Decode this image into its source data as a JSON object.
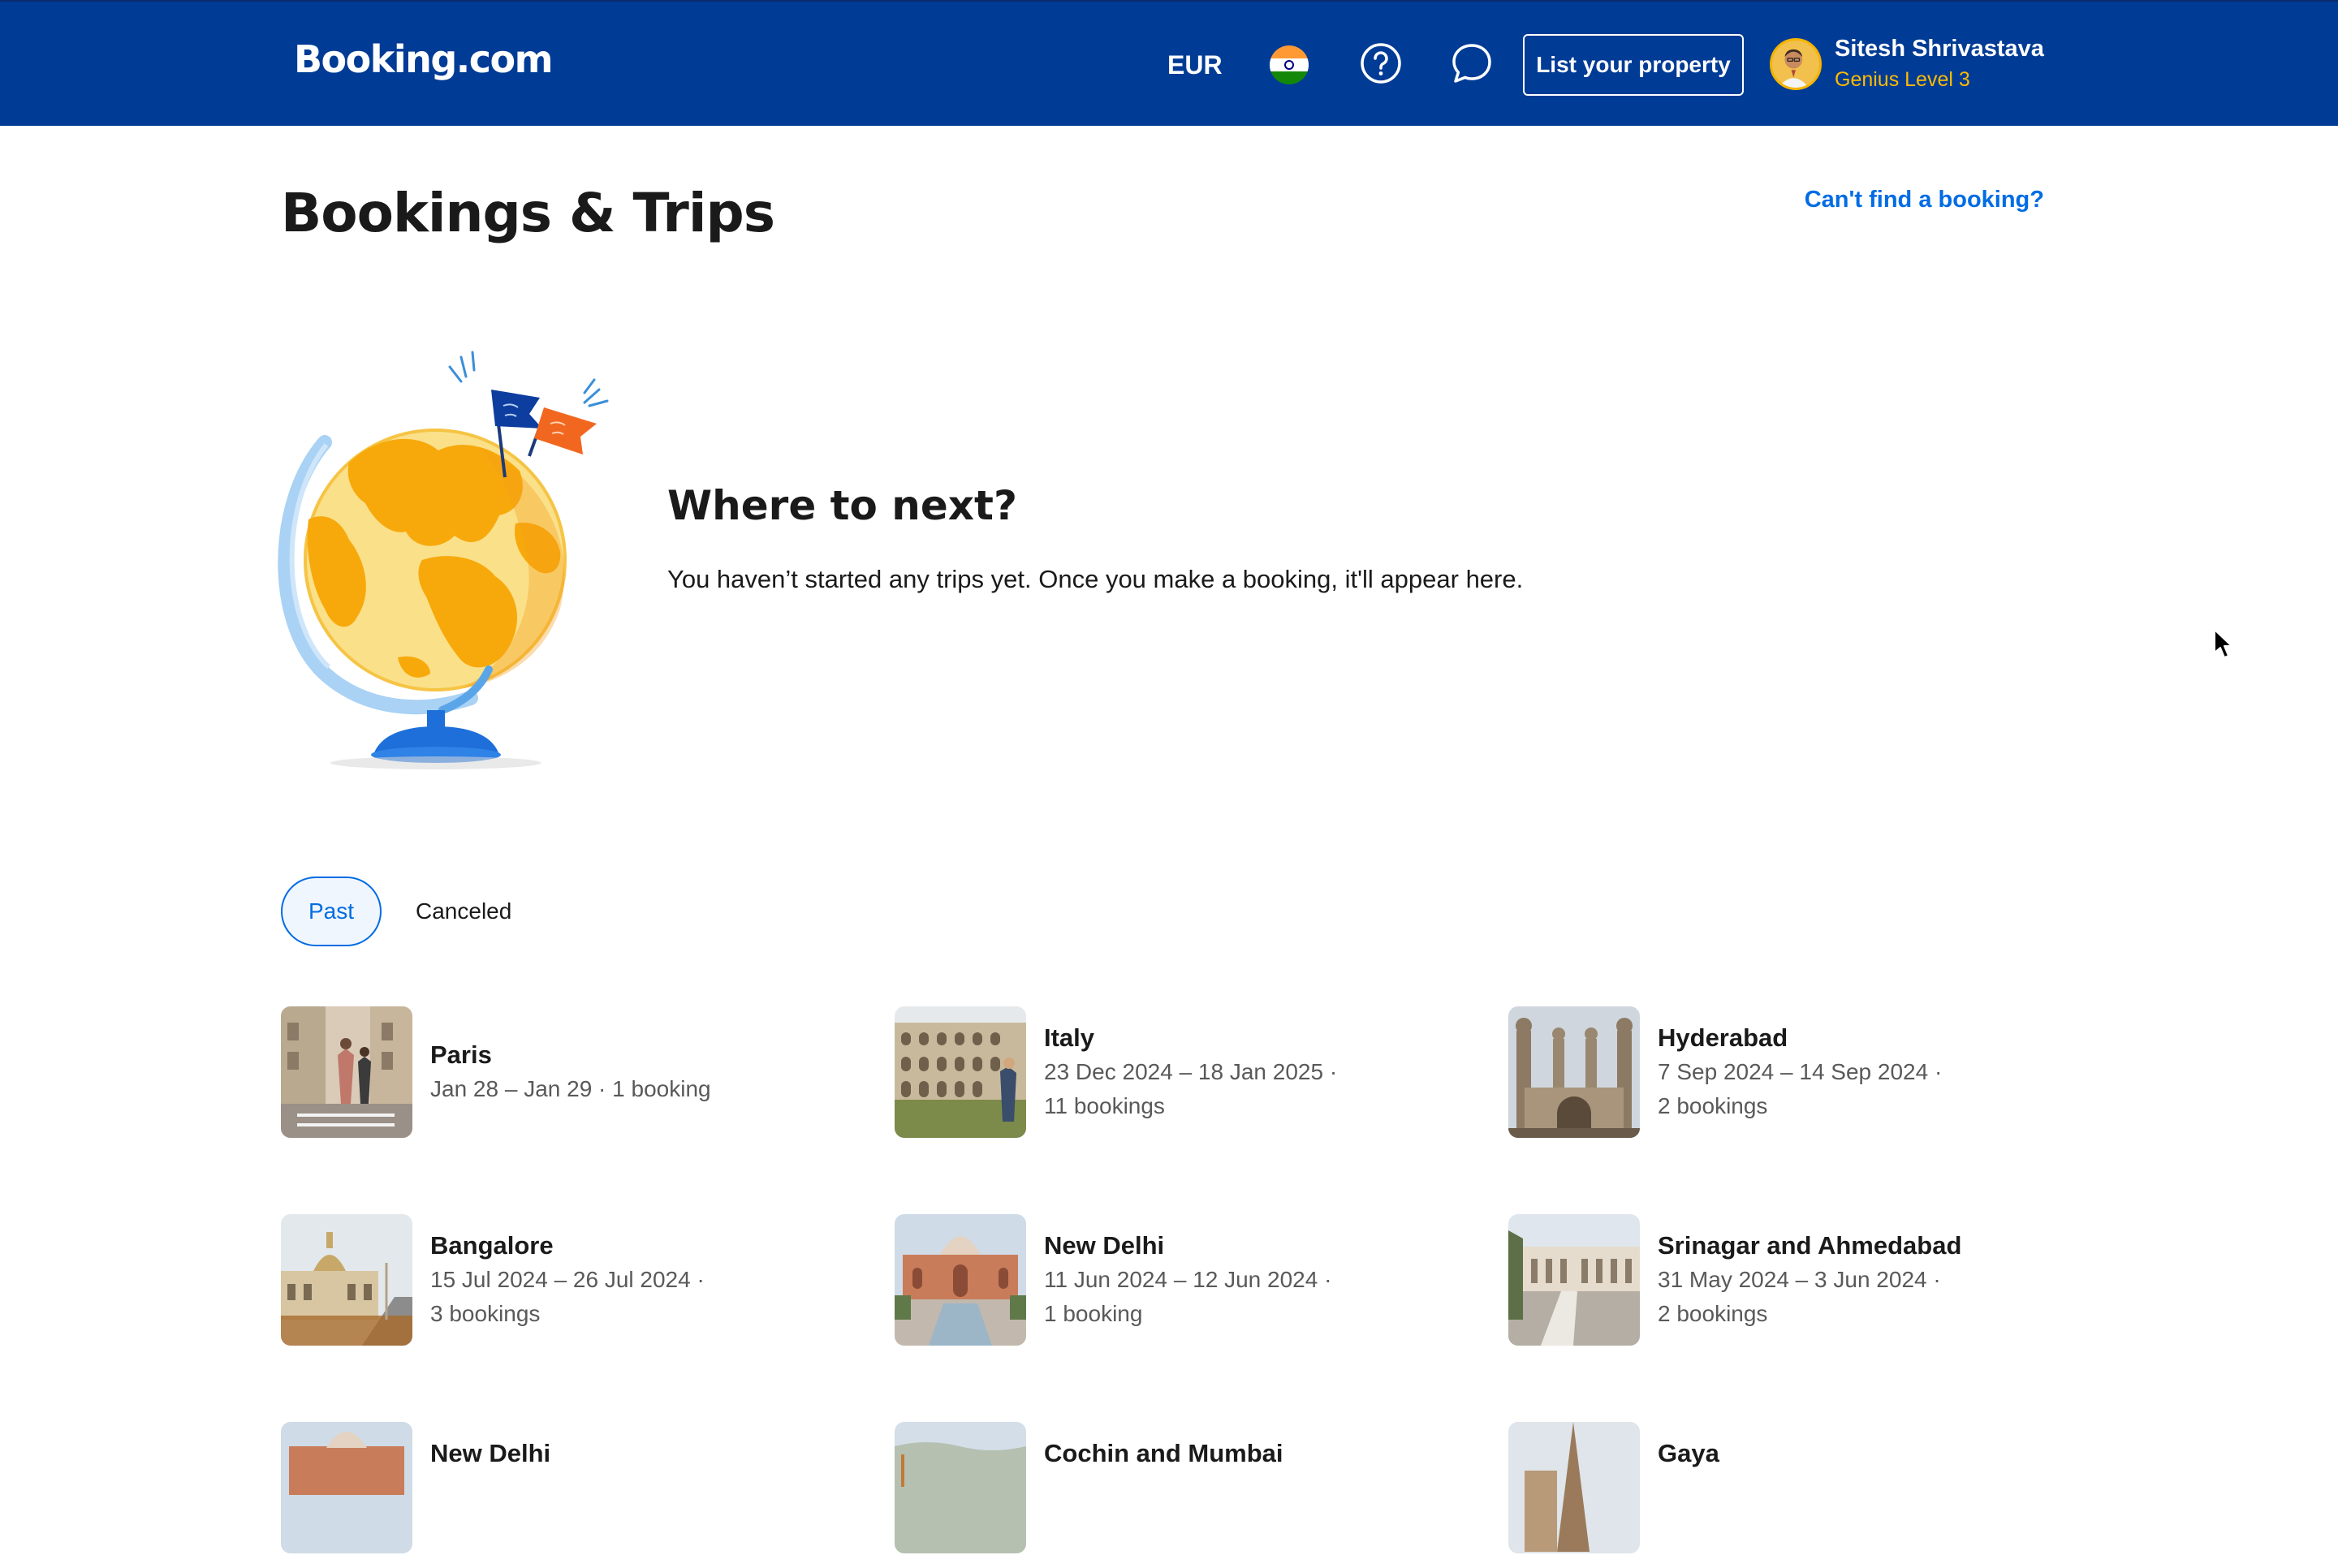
{
  "header": {
    "logo": "Booking.com",
    "currency": "EUR",
    "language_flag": "india-flag",
    "help_icon": "question-circle-icon",
    "messages_icon": "chat-bubble-icon",
    "list_property_label": "List your property",
    "user_name": "Sitesh Shrivastava",
    "user_level": "Genius Level 3",
    "bg_color": "#003b95",
    "level_color": "#febb02"
  },
  "page": {
    "title": "Bookings & Trips",
    "cant_find_link": "Can't find a booking?",
    "empty_state": {
      "title": "Where to next?",
      "text": "You haven’t started any trips yet. Once you make a booking, it'll appear here."
    },
    "link_color": "#006ce4"
  },
  "tabs": [
    {
      "label": "Past",
      "active": true
    },
    {
      "label": "Canceled",
      "active": false
    }
  ],
  "trips": [
    {
      "name": "Paris",
      "dates": "Jan 28 – Jan 29 · 1 booking",
      "count": ""
    },
    {
      "name": "Italy",
      "dates": "23 Dec 2024 – 18 Jan 2025 ·",
      "count": "11 bookings"
    },
    {
      "name": "Hyderabad",
      "dates": "7 Sep 2024 – 14 Sep 2024 ·",
      "count": "2 bookings"
    },
    {
      "name": "Bangalore",
      "dates": "15 Jul 2024 – 26 Jul 2024 ·",
      "count": "3 bookings"
    },
    {
      "name": "New Delhi",
      "dates": "11 Jun 2024 – 12 Jun 2024 ·",
      "count": "1 booking"
    },
    {
      "name": "Srinagar and Ahmedabad",
      "dates": "31 May 2024 – 3 Jun 2024 ·",
      "count": "2 bookings"
    },
    {
      "name": "New Delhi",
      "dates": "",
      "count": ""
    },
    {
      "name": "Cochin and Mumbai",
      "dates": "",
      "count": ""
    },
    {
      "name": "Gaya",
      "dates": "",
      "count": ""
    }
  ]
}
